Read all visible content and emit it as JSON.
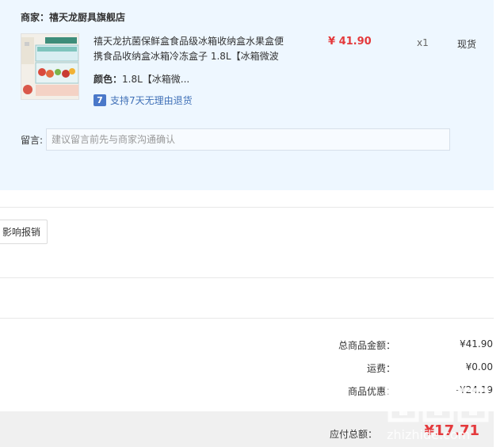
{
  "order": {
    "merchant_label": "商家：禧天龙厨具旗舰店",
    "product": {
      "title": "禧天龙抗菌保鲜盒食品级冰箱收纳盒水果盒便携食品收纳盒冰箱冷冻盒子 1.8L【冰箱微波",
      "price": "¥ 41.90",
      "qty": "x1",
      "stock": "现货",
      "color_label": "颜色：",
      "color_value": "1.8L【冰箱微...",
      "return_badge": "7",
      "return_text": "支持7天无理由退货"
    },
    "remark": {
      "label": "留言:",
      "placeholder": "建议留言前先与商家沟通确认"
    }
  },
  "invoice": {
    "reimburse_button": "影响报销"
  },
  "summary": {
    "total_goods_label": "总商品金额：",
    "total_goods_value": "¥41.90",
    "shipping_label": "运费：",
    "shipping_value": "¥0.00",
    "discount_label": "商品优惠：",
    "discount_value": "-¥24.19",
    "payable_label": "应付总额：",
    "payable_value": "¥17.71"
  },
  "watermark_text": "值 什么值得买",
  "colors": {
    "panel_bg": "#eef7ff",
    "price_red": "#e4393c",
    "link_blue": "#4070b7"
  }
}
